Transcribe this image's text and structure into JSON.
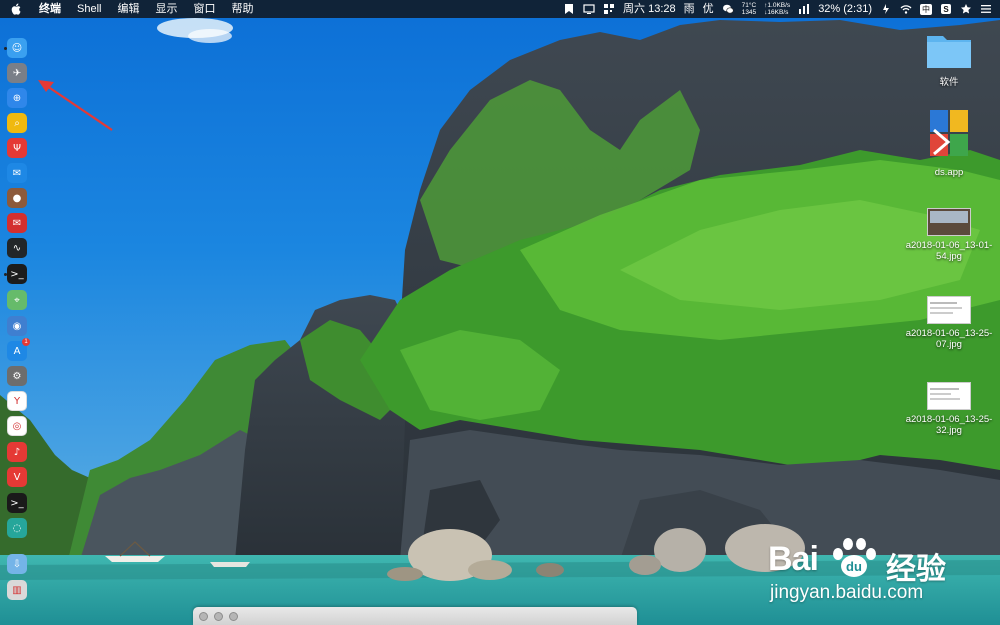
{
  "menubar": {
    "app_name": "终端",
    "menus": [
      "Shell",
      "编辑",
      "显示",
      "窗口",
      "帮助"
    ],
    "status": {
      "datetime": "周六 13:28",
      "weather": "雨",
      "air": "优",
      "temp_cpu": "71°C",
      "fan": "1345",
      "net_up": "↑1.0KB/s",
      "net_down": "↓16KB/s",
      "battery": "32% (2:31)",
      "input_method": "中"
    },
    "status_icons": [
      "bookmark-icon",
      "display-icon",
      "qr-icon",
      "wechat-icon",
      "stats-icon",
      "battery-icon",
      "wifi-icon",
      "input-method-icon",
      "skype-icon",
      "star-icon",
      "list-icon"
    ]
  },
  "dock": {
    "items": [
      {
        "name": "finder",
        "color": "#3aa0f0",
        "running": true
      },
      {
        "name": "launchpad",
        "color": "#7a7f88",
        "running": false
      },
      {
        "name": "safari",
        "color": "#2f87ea",
        "running": false
      },
      {
        "name": "image-search",
        "color": "#f0b90f",
        "running": false
      },
      {
        "name": "app-red-fork",
        "color": "#e53935",
        "running": false
      },
      {
        "name": "chat-app",
        "color": "#1e88e5",
        "running": false
      },
      {
        "name": "wood-ball",
        "color": "#8d5a3b",
        "running": false
      },
      {
        "name": "mail-red",
        "color": "#d32f2f",
        "running": false
      },
      {
        "name": "activity-monitor",
        "color": "#222629",
        "running": false
      },
      {
        "name": "terminal",
        "color": "#1c1c1c",
        "running": true
      },
      {
        "name": "maps",
        "color": "#66bb6a",
        "running": false
      },
      {
        "name": "siri",
        "color": "#3f7fd0",
        "running": false
      },
      {
        "name": "app-store",
        "color": "#1e88e5",
        "running": false,
        "badge": "1"
      },
      {
        "name": "system-preferences",
        "color": "#6d6d6d",
        "running": false
      },
      {
        "name": "yandex",
        "color": "#ffffff",
        "running": false
      },
      {
        "name": "chrome",
        "color": "#ffffff",
        "running": false
      },
      {
        "name": "netease-music",
        "color": "#e53935",
        "running": false
      },
      {
        "name": "vivaldi",
        "color": "#e53935",
        "running": false
      },
      {
        "name": "terminal-2",
        "color": "#1a1a1a",
        "running": false
      },
      {
        "name": "chat-bubble",
        "color": "#26a69a",
        "running": false
      },
      {
        "name": "downloads",
        "color": "#74b4e8",
        "running": false
      },
      {
        "name": "trash",
        "color": "#d9d9d9",
        "running": false
      }
    ]
  },
  "desktop": {
    "icons": [
      {
        "label": "软件",
        "kind": "folder"
      },
      {
        "label": "ds.app",
        "kind": "app"
      },
      {
        "label": "a2018-01-06_13-01-54.jpg",
        "kind": "image"
      },
      {
        "label": "a2018-01-06_13-25-07.jpg",
        "kind": "image"
      },
      {
        "label": "a2018-01-06_13-25-32.jpg",
        "kind": "image"
      }
    ]
  },
  "watermark": {
    "logo": "Bai",
    "logo_suffix": "经验",
    "url": "jingyan.baidu.com"
  },
  "annotation": {
    "color": "#e53935"
  }
}
